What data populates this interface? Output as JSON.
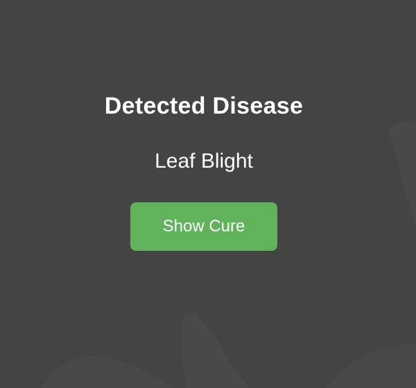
{
  "result": {
    "heading": "Detected Disease",
    "disease_name": "Leaf Blight",
    "cure_button_label": "Show Cure"
  },
  "colors": {
    "background": "#434443",
    "button": "#61b35b",
    "text": "#ffffff",
    "leaf_silhouette": "#4c4e4b"
  }
}
